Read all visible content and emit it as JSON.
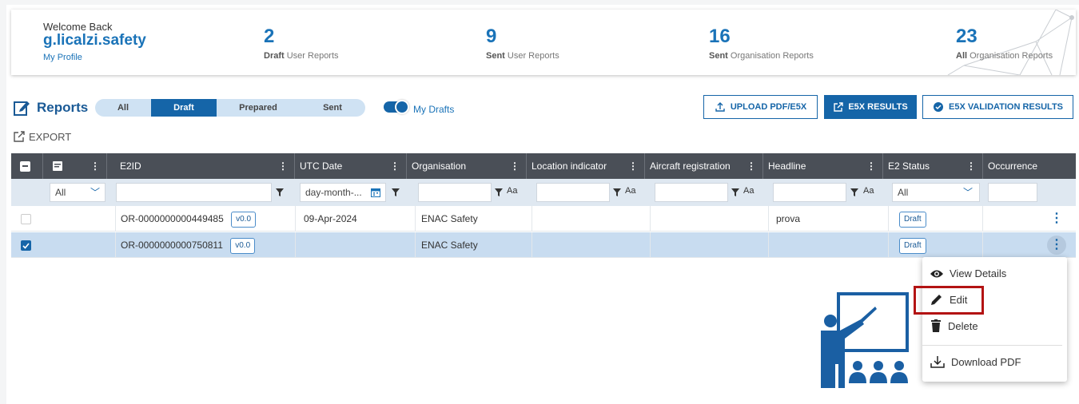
{
  "header": {
    "welcome": "Welcome Back",
    "username": "g.licalzi.safety",
    "profile_link": "My Profile"
  },
  "stats": [
    {
      "value": "2",
      "bold": "Draft",
      "label": "User Reports"
    },
    {
      "value": "9",
      "bold": "Sent",
      "label": "User Reports"
    },
    {
      "value": "16",
      "bold": "Sent",
      "label": "Organisation Reports"
    },
    {
      "value": "23",
      "bold": "All",
      "label": "Organisation Reports"
    }
  ],
  "toolbar": {
    "title": "Reports",
    "filters": [
      "All",
      "Draft",
      "Prepared",
      "Sent"
    ],
    "active_filter": "Draft",
    "toggle_label": "My Drafts",
    "upload_label": "UPLOAD PDF/E5X",
    "e5x_results_label": "E5X RESULTS",
    "validation_label": "E5X VALIDATION RESULTS",
    "export_label": "EXPORT"
  },
  "table": {
    "columns": [
      "E2ID",
      "UTC Date",
      "Organisation",
      "Location indicator",
      "Aircraft registration",
      "Headline",
      "E2 Status",
      "Occurrence"
    ],
    "filters": {
      "type_select": "All",
      "date_placeholder": "day-month-...",
      "text_case_label": "Aa",
      "status_select": "All"
    },
    "rows": [
      {
        "e2id": "OR-0000000000449485",
        "version": "v0.0",
        "date": "09-Apr-2024",
        "organisation": "ENAC Safety",
        "location": "",
        "aircraft": "",
        "headline": "prova",
        "status": "Draft",
        "selected": false
      },
      {
        "e2id": "OR-0000000000750811",
        "version": "v0.0",
        "date": "",
        "organisation": "ENAC Safety",
        "location": "",
        "aircraft": "",
        "headline": "",
        "status": "Draft",
        "selected": true
      }
    ]
  },
  "context_menu": {
    "items": [
      "View Details",
      "Edit",
      "Delete",
      "Download PDF"
    ],
    "highlighted": "Edit"
  },
  "colors": {
    "accent": "#1565a8",
    "header_bg": "#4a4f57",
    "highlight_box": "#b31313"
  }
}
